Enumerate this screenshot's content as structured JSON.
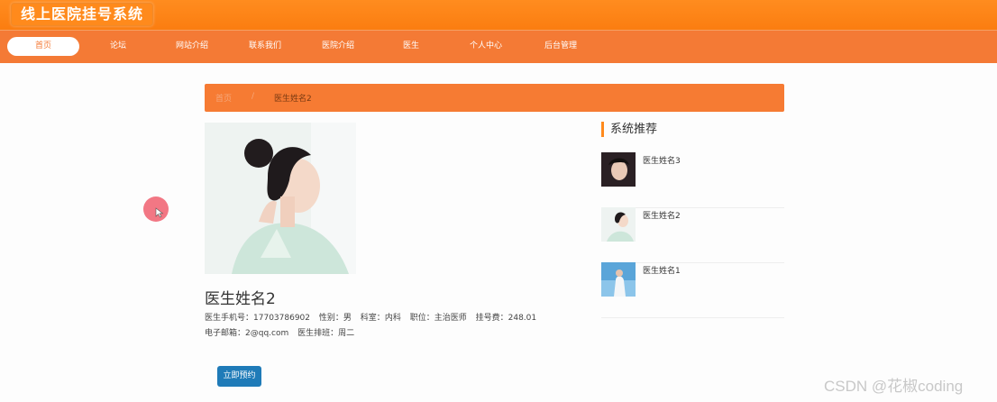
{
  "header": {
    "title": "线上医院挂号系统"
  },
  "nav": {
    "items": [
      {
        "label": "首页",
        "active": true
      },
      {
        "label": "论坛"
      },
      {
        "label": "网站介绍"
      },
      {
        "label": "联系我们"
      },
      {
        "label": "医院介绍"
      },
      {
        "label": "医生"
      },
      {
        "label": "个人中心"
      },
      {
        "label": "后台管理"
      }
    ]
  },
  "breadcrumb": {
    "home": "首页",
    "separator": "/",
    "current": "医生姓名2"
  },
  "doctor": {
    "name": "医生姓名2",
    "phone_label": "医生手机号：",
    "phone": "17703786902",
    "gender_label": "性别：",
    "gender": "男",
    "department_label": "科室：",
    "department": "内科",
    "title_label": "职位：",
    "title": "主治医师",
    "fee_label": "挂号费：",
    "fee": "248.01",
    "email_label": "电子邮箱：",
    "email": "2@qq.com",
    "schedule_label": "医生排班：",
    "schedule": "周二",
    "book_button": "立即预约"
  },
  "sidebar": {
    "title": "系统推荐",
    "items": [
      {
        "name": "医生姓名3"
      },
      {
        "name": "医生姓名2"
      },
      {
        "name": "医生姓名1"
      }
    ]
  },
  "watermark": "CSDN @花椒coding",
  "colors": {
    "brand_orange": "#f47a35",
    "header_orange": "#ff8c1f",
    "button_blue": "#1f7bb8"
  }
}
